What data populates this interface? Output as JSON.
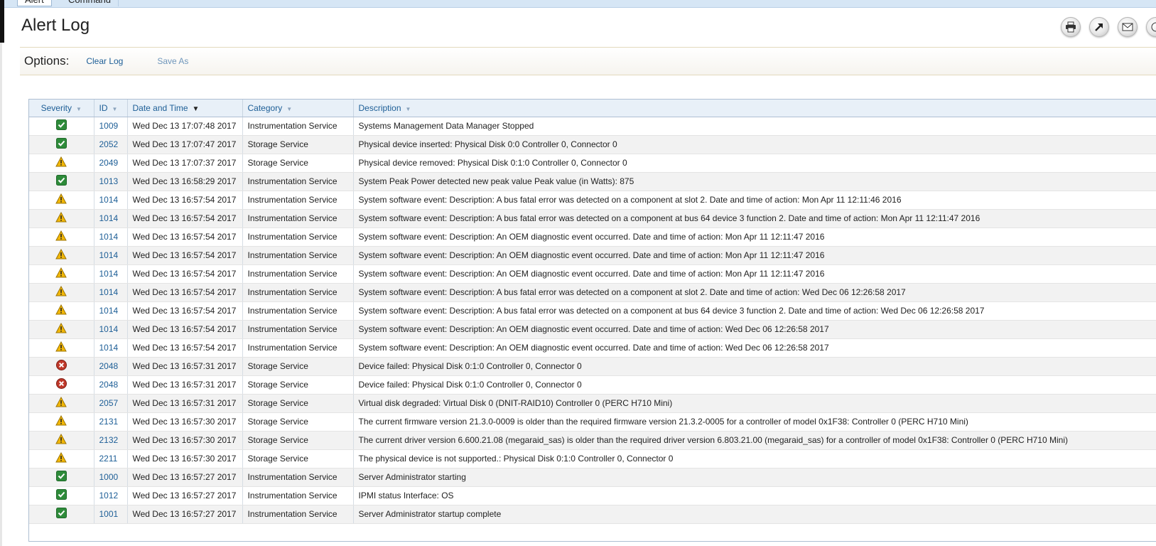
{
  "tabs": [
    {
      "label": "Alert"
    },
    {
      "label": "Command"
    }
  ],
  "page": {
    "title": "Alert Log",
    "toolbar": [
      {
        "icon": "print-icon"
      },
      {
        "icon": "export-icon"
      },
      {
        "icon": "email-icon"
      }
    ]
  },
  "options": {
    "label": "Options:",
    "clear_log": "Clear Log",
    "save_as": "Save As"
  },
  "table": {
    "columns": {
      "severity": "Severity",
      "id": "ID",
      "datetime": "Date and Time",
      "category": "Category",
      "description": "Description"
    },
    "sorted_by": "datetime",
    "rows": [
      {
        "severity": "ok",
        "id": "1009",
        "datetime": "Wed Dec 13 17:07:48 2017",
        "category": "Instrumentation Service",
        "description": "Systems Management Data Manager Stopped"
      },
      {
        "severity": "ok",
        "id": "2052",
        "datetime": "Wed Dec 13 17:07:47 2017",
        "category": "Storage Service",
        "description": "Physical device inserted: Physical Disk 0:0 Controller 0, Connector 0"
      },
      {
        "severity": "warning",
        "id": "2049",
        "datetime": "Wed Dec 13 17:07:37 2017",
        "category": "Storage Service",
        "description": "Physical device removed: Physical Disk 0:1:0 Controller 0, Connector 0"
      },
      {
        "severity": "ok",
        "id": "1013",
        "datetime": "Wed Dec 13 16:58:29 2017",
        "category": "Instrumentation Service",
        "description": "System Peak Power detected new peak value Peak value (in Watts): 875"
      },
      {
        "severity": "warning",
        "id": "1014",
        "datetime": "Wed Dec 13 16:57:54 2017",
        "category": "Instrumentation Service",
        "description": "System software event: Description: A bus fatal error was detected on a component at slot 2. Date and time of action: Mon Apr 11 12:11:46 2016"
      },
      {
        "severity": "warning",
        "id": "1014",
        "datetime": "Wed Dec 13 16:57:54 2017",
        "category": "Instrumentation Service",
        "description": "System software event: Description: A bus fatal error was detected on a component at bus 64 device 3 function 2. Date and time of action: Mon Apr 11 12:11:47 2016"
      },
      {
        "severity": "warning",
        "id": "1014",
        "datetime": "Wed Dec 13 16:57:54 2017",
        "category": "Instrumentation Service",
        "description": "System software event: Description: An OEM diagnostic event occurred. Date and time of action: Mon Apr 11 12:11:47 2016"
      },
      {
        "severity": "warning",
        "id": "1014",
        "datetime": "Wed Dec 13 16:57:54 2017",
        "category": "Instrumentation Service",
        "description": "System software event: Description: An OEM diagnostic event occurred. Date and time of action: Mon Apr 11 12:11:47 2016"
      },
      {
        "severity": "warning",
        "id": "1014",
        "datetime": "Wed Dec 13 16:57:54 2017",
        "category": "Instrumentation Service",
        "description": "System software event: Description: An OEM diagnostic event occurred. Date and time of action: Mon Apr 11 12:11:47 2016"
      },
      {
        "severity": "warning",
        "id": "1014",
        "datetime": "Wed Dec 13 16:57:54 2017",
        "category": "Instrumentation Service",
        "description": "System software event: Description: A bus fatal error was detected on a component at slot 2. Date and time of action: Wed Dec 06 12:26:58 2017"
      },
      {
        "severity": "warning",
        "id": "1014",
        "datetime": "Wed Dec 13 16:57:54 2017",
        "category": "Instrumentation Service",
        "description": "System software event: Description: A bus fatal error was detected on a component at bus 64 device 3 function 2. Date and time of action: Wed Dec 06 12:26:58 2017"
      },
      {
        "severity": "warning",
        "id": "1014",
        "datetime": "Wed Dec 13 16:57:54 2017",
        "category": "Instrumentation Service",
        "description": "System software event: Description: An OEM diagnostic event occurred. Date and time of action: Wed Dec 06 12:26:58 2017"
      },
      {
        "severity": "warning",
        "id": "1014",
        "datetime": "Wed Dec 13 16:57:54 2017",
        "category": "Instrumentation Service",
        "description": "System software event: Description: An OEM diagnostic event occurred. Date and time of action: Wed Dec 06 12:26:58 2017"
      },
      {
        "severity": "critical",
        "id": "2048",
        "datetime": "Wed Dec 13 16:57:31 2017",
        "category": "Storage Service",
        "description": "Device failed: Physical Disk 0:1:0 Controller 0, Connector 0"
      },
      {
        "severity": "critical",
        "id": "2048",
        "datetime": "Wed Dec 13 16:57:31 2017",
        "category": "Storage Service",
        "description": "Device failed: Physical Disk 0:1:0 Controller 0, Connector 0"
      },
      {
        "severity": "warning",
        "id": "2057",
        "datetime": "Wed Dec 13 16:57:31 2017",
        "category": "Storage Service",
        "description": "Virtual disk degraded: Virtual Disk 0 (DNIT-RAID10) Controller 0 (PERC H710 Mini)"
      },
      {
        "severity": "warning",
        "id": "2131",
        "datetime": "Wed Dec 13 16:57:30 2017",
        "category": "Storage Service",
        "description": "The current firmware version 21.3.0-0009 is older than the required firmware version 21.3.2-0005 for a controller of model 0x1F38: Controller 0 (PERC H710 Mini)"
      },
      {
        "severity": "warning",
        "id": "2132",
        "datetime": "Wed Dec 13 16:57:30 2017",
        "category": "Storage Service",
        "description": "The current driver version 6.600.21.08 (megaraid_sas) is older than the required driver version 6.803.21.00 (megaraid_sas) for a controller of model 0x1F38: Controller 0 (PERC H710 Mini)"
      },
      {
        "severity": "warning",
        "id": "2211",
        "datetime": "Wed Dec 13 16:57:30 2017",
        "category": "Storage Service",
        "description": "The physical device is not supported.: Physical Disk 0:1:0 Controller 0, Connector 0"
      },
      {
        "severity": "ok",
        "id": "1000",
        "datetime": "Wed Dec 13 16:57:27 2017",
        "category": "Instrumentation Service",
        "description": "Server Administrator starting"
      },
      {
        "severity": "ok",
        "id": "1012",
        "datetime": "Wed Dec 13 16:57:27 2017",
        "category": "Instrumentation Service",
        "description": "IPMI status Interface: OS"
      },
      {
        "severity": "ok",
        "id": "1001",
        "datetime": "Wed Dec 13 16:57:27 2017",
        "category": "Instrumentation Service",
        "description": "Server Administrator startup complete"
      }
    ]
  },
  "colors": {
    "link": "#1d5e96",
    "ok": "#2e8b3a",
    "warning": "#f2b707",
    "critical": "#c0392b"
  }
}
